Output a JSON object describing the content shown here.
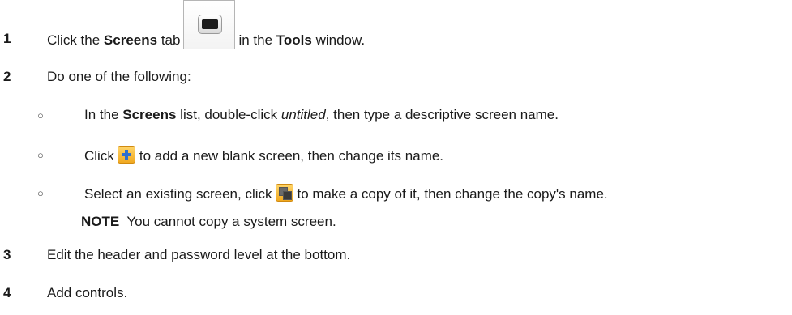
{
  "steps": [
    {
      "number": "1",
      "pre": "Click the ",
      "bold1": "Screens",
      "mid": " tab",
      "post": "in the ",
      "bold2": "Tools",
      "end": " window."
    },
    {
      "number": "2",
      "text": "Do one of the following:"
    },
    {
      "number": "3",
      "text": "Edit the header and password level at the bottom."
    },
    {
      "number": "4",
      "text": "Add controls."
    }
  ],
  "options": [
    {
      "bullet": "○",
      "pre": "In the ",
      "bold": "Screens",
      "mid": " list, double-click ",
      "italic": "untitled",
      "post": ", then type a descriptive screen name."
    },
    {
      "bullet": "○",
      "pre": "Click",
      "post": "to add a new blank screen, then change its name."
    },
    {
      "bullet": "○",
      "pre": "Select an existing screen, click",
      "post": "to make a copy of it, then change the copy's name."
    }
  ],
  "note": {
    "label": "NOTE",
    "text": "You cannot copy a system screen."
  },
  "icons": {
    "screens_tab": "screen-monitor-icon",
    "add": "plus-icon",
    "copy": "copy-screen-icon"
  }
}
